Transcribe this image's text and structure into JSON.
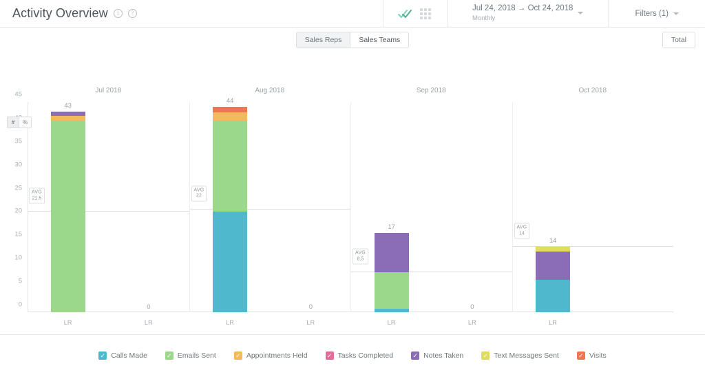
{
  "header": {
    "title": "Activity Overview",
    "info_icon": "info-icon",
    "help_icon": "help-icon",
    "chart_view_icon": "activity-check-icon",
    "grid_view_icon": "grid-icon",
    "date_range": "Jul 24, 2018 → Oct 24, 2018",
    "date_granularity": "Monthly",
    "filters_label": "Filters (1)"
  },
  "subbar": {
    "tabs": [
      {
        "label": "Sales Reps",
        "active": false
      },
      {
        "label": "Sales Teams",
        "active": true
      }
    ],
    "total_label": "Total"
  },
  "unit_toggle": {
    "options": [
      {
        "label": "#",
        "active": true
      },
      {
        "label": "%",
        "active": false
      }
    ]
  },
  "colors": {
    "calls_made": "#4fb8cd",
    "emails_sent": "#9bd88b",
    "appointments_held": "#f3b95a",
    "tasks_completed": "#e06d9a",
    "notes_taken": "#8a6db5",
    "text_messages_sent": "#e1dd5c",
    "visits": "#f0764f",
    "axis": "#a9b0b5",
    "avg_line": "#d8dcdf"
  },
  "legend": [
    {
      "label": "Calls Made",
      "color": "#4fb8cd",
      "checked": true
    },
    {
      "label": "Emails Sent",
      "color": "#9bd88b",
      "checked": true
    },
    {
      "label": "Appointments Held",
      "color": "#f3b95a",
      "checked": true
    },
    {
      "label": "Tasks Completed",
      "color": "#e06d9a",
      "checked": true
    },
    {
      "label": "Notes Taken",
      "color": "#8a6db5",
      "checked": true
    },
    {
      "label": "Text Messages Sent",
      "color": "#e1dd5c",
      "checked": true
    },
    {
      "label": "Visits",
      "color": "#f0764f",
      "checked": true
    }
  ],
  "chart_data": {
    "type": "bar",
    "stacked": true,
    "title": "Activity Overview",
    "xlabel": "",
    "ylabel": "",
    "ylim": [
      0,
      45
    ],
    "yticks": [
      0,
      5,
      10,
      15,
      20,
      25,
      30,
      35,
      40,
      45
    ],
    "grid": false,
    "legend_position": "bottom",
    "series": [
      {
        "name": "Calls Made",
        "color": "#4fb8cd",
        "values": [
          0,
          0,
          21.5,
          0,
          0.7,
          0,
          7.0,
          0
        ]
      },
      {
        "name": "Emails Sent",
        "color": "#9bd88b",
        "values": [
          41,
          0,
          19.5,
          0,
          7.8,
          0,
          0,
          0
        ]
      },
      {
        "name": "Appointments Held",
        "color": "#f3b95a",
        "values": [
          1,
          0,
          1.8,
          0,
          0,
          0,
          0,
          0
        ]
      },
      {
        "name": "Tasks Completed",
        "color": "#e06d9a",
        "values": [
          0,
          0,
          0,
          0,
          0,
          0,
          0,
          0
        ]
      },
      {
        "name": "Notes Taken",
        "color": "#8a6db5",
        "values": [
          1,
          0,
          0,
          0,
          8.5,
          0,
          6.0,
          0
        ]
      },
      {
        "name": "Text Messages Sent",
        "color": "#e1dd5c",
        "values": [
          0,
          0,
          0,
          0,
          0,
          0,
          1.0,
          0
        ]
      },
      {
        "name": "Visits",
        "color": "#f0764f",
        "values": [
          0,
          0,
          1.2,
          0,
          0,
          0,
          0,
          0
        ]
      }
    ],
    "groups": [
      {
        "month": "Jul 2018",
        "avg_label": "AVG",
        "avg_value": "21.5",
        "avg_numeric": 21.5,
        "bars": [
          {
            "xlabel": "LR",
            "total": "43",
            "total_numeric": 43,
            "segments": [
              {
                "name": "Emails Sent",
                "value": 41,
                "color": "#9bd88b"
              },
              {
                "name": "Appointments Held",
                "value": 1,
                "color": "#f3b95a"
              },
              {
                "name": "Notes Taken",
                "value": 1,
                "color": "#8a6db5"
              }
            ]
          },
          {
            "xlabel": "LR",
            "total": "0",
            "total_numeric": 0,
            "segments": []
          }
        ]
      },
      {
        "month": "Aug 2018",
        "avg_label": "AVG",
        "avg_value": "22",
        "avg_numeric": 22,
        "bars": [
          {
            "xlabel": "LR",
            "total": "44",
            "total_numeric": 44,
            "segments": [
              {
                "name": "Calls Made",
                "value": 21.5,
                "color": "#4fb8cd"
              },
              {
                "name": "Emails Sent",
                "value": 19.5,
                "color": "#9bd88b"
              },
              {
                "name": "Appointments Held",
                "value": 1.8,
                "color": "#f3b95a"
              },
              {
                "name": "Visits",
                "value": 1.2,
                "color": "#f0764f"
              }
            ]
          },
          {
            "xlabel": "LR",
            "total": "0",
            "total_numeric": 0,
            "segments": []
          }
        ]
      },
      {
        "month": "Sep 2018",
        "avg_label": "AVG",
        "avg_value": "8.5",
        "avg_numeric": 8.5,
        "bars": [
          {
            "xlabel": "LR",
            "total": "17",
            "total_numeric": 17,
            "segments": [
              {
                "name": "Calls Made",
                "value": 0.7,
                "color": "#4fb8cd"
              },
              {
                "name": "Emails Sent",
                "value": 7.8,
                "color": "#9bd88b"
              },
              {
                "name": "Notes Taken",
                "value": 8.5,
                "color": "#8a6db5"
              }
            ]
          },
          {
            "xlabel": "LR",
            "total": "0",
            "total_numeric": 0,
            "segments": []
          }
        ]
      },
      {
        "month": "Oct 2018",
        "avg_label": "AVG",
        "avg_value": "14",
        "avg_numeric": 14,
        "bars": [
          {
            "xlabel": "LR",
            "total": "14",
            "total_numeric": 14,
            "segments": [
              {
                "name": "Calls Made",
                "value": 7.0,
                "color": "#4fb8cd"
              },
              {
                "name": "Notes Taken",
                "value": 6.0,
                "color": "#8a6db5"
              },
              {
                "name": "Text Messages Sent",
                "value": 1.0,
                "color": "#e1dd5c"
              }
            ]
          }
        ]
      }
    ]
  }
}
